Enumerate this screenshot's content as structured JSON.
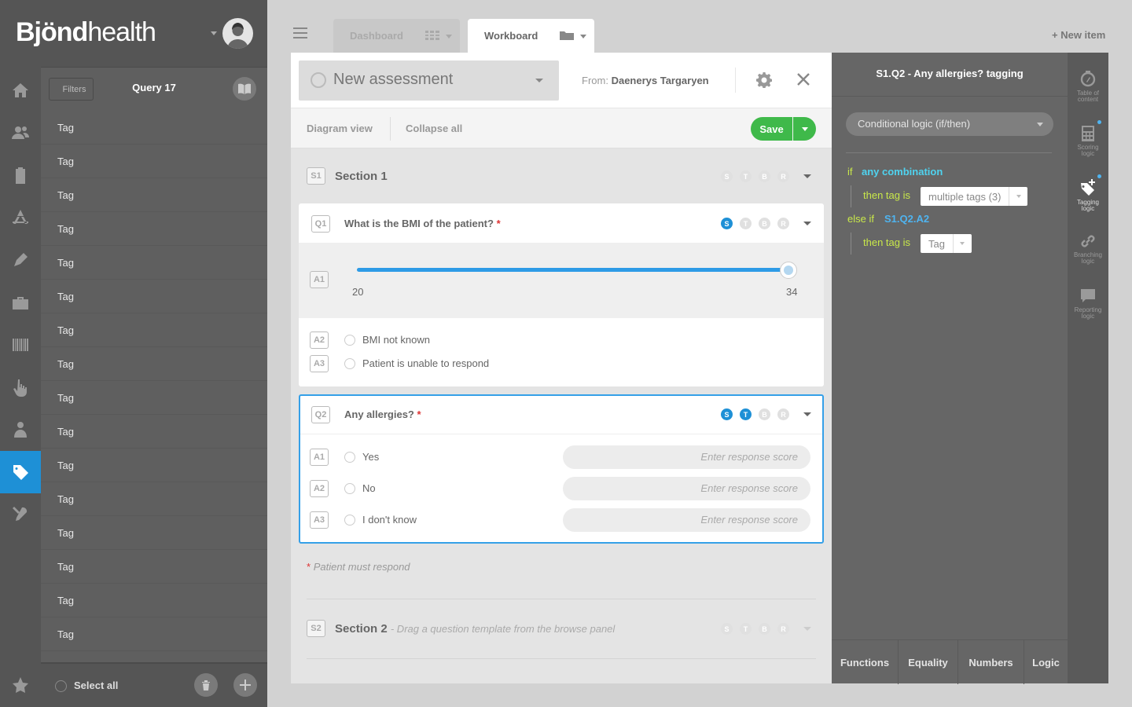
{
  "brand": {
    "logo_bold": "Bjönd",
    "logo_light": "health"
  },
  "rail": {
    "icons": [
      "home-icon",
      "users-icon",
      "clipboard-icon",
      "apps-icon",
      "pen-icon",
      "briefcase-icon",
      "barcode-icon",
      "touch-icon",
      "person-icon",
      "tag-icon",
      "tools-icon",
      "star-icon"
    ],
    "active": "tag-icon"
  },
  "list": {
    "filters_label": "Filters",
    "title": "Query 17",
    "items": [
      "Tag",
      "Tag",
      "Tag",
      "Tag",
      "Tag",
      "Tag",
      "Tag",
      "Tag",
      "Tag",
      "Tag",
      "Tag",
      "Tag",
      "Tag",
      "Tag",
      "Tag",
      "Tag"
    ],
    "select_all": "Select all"
  },
  "topbar": {
    "tabs": [
      {
        "label": "Dashboard"
      },
      {
        "label": "Workboard"
      }
    ],
    "new_item": "+ New item"
  },
  "assessment": {
    "title": "New assessment",
    "from_label": "From:",
    "from_name": "Daenerys Targaryen",
    "diagram_view": "Diagram view",
    "collapse_all": "Collapse all",
    "save": "Save"
  },
  "section1": {
    "badge": "S1",
    "title": "Section 1",
    "flags": [
      "S",
      "T",
      "B",
      "R"
    ]
  },
  "q1": {
    "badge": "Q1",
    "title": "What is the BMI of the patient?",
    "required": "*",
    "flags": [
      "S",
      "T",
      "B",
      "R"
    ],
    "a1_badge": "A1",
    "slider_min": "20",
    "slider_max": "34",
    "slider_value_fraction": 1.0,
    "answers": [
      {
        "badge": "A2",
        "label": "BMI not known"
      },
      {
        "badge": "A3",
        "label": "Patient is unable to respond"
      }
    ]
  },
  "q2": {
    "badge": "Q2",
    "title": "Any allergies?",
    "required": "*",
    "flags": [
      "S",
      "T",
      "B",
      "R"
    ],
    "answers": [
      {
        "badge": "A1",
        "label": "Yes",
        "placeholder": "Enter response score"
      },
      {
        "badge": "A2",
        "label": "No",
        "placeholder": "Enter response score"
      },
      {
        "badge": "A3",
        "label": "I don't know",
        "placeholder": "Enter response score"
      }
    ]
  },
  "must_respond": {
    "star": "*",
    "text": "Patient must respond"
  },
  "section2": {
    "badge": "S2",
    "title": "Section 2",
    "hint": "- Drag a question template from the browse panel",
    "flags": [
      "S",
      "T",
      "B",
      "R"
    ]
  },
  "logic": {
    "title": "S1.Q2 - Any allergies? tagging",
    "select": "Conditional logic (if/then)",
    "if_kw": "if",
    "if_value": "any combination",
    "then_kw": "then tag is",
    "then_value_1": "multiple tags (3)",
    "else_if_kw": "else if",
    "else_if_value": "S1.Q2.A2",
    "then_kw_2": "then tag is",
    "then_value_2": "Tag",
    "footer_tabs": [
      "Functions",
      "Equality",
      "Numbers",
      "Logic"
    ]
  },
  "side_panel": {
    "items": [
      {
        "icon": "compass-icon",
        "label_1": "Table of",
        "label_2": "content"
      },
      {
        "icon": "calculator-icon",
        "label_1": "Scoring",
        "label_2": "logic"
      },
      {
        "icon": "tag-plus-icon",
        "label_1": "Tagging",
        "label_2": "logic"
      },
      {
        "icon": "link-icon",
        "label_1": "Branching",
        "label_2": "logic"
      },
      {
        "icon": "speech-icon",
        "label_1": "Reporting",
        "label_2": "logic"
      }
    ]
  },
  "colors": {
    "accent": "#1e90d6",
    "save": "#3fb94a",
    "logic_kw": "#c9e84a",
    "logic_ref": "#4fd3f0"
  }
}
